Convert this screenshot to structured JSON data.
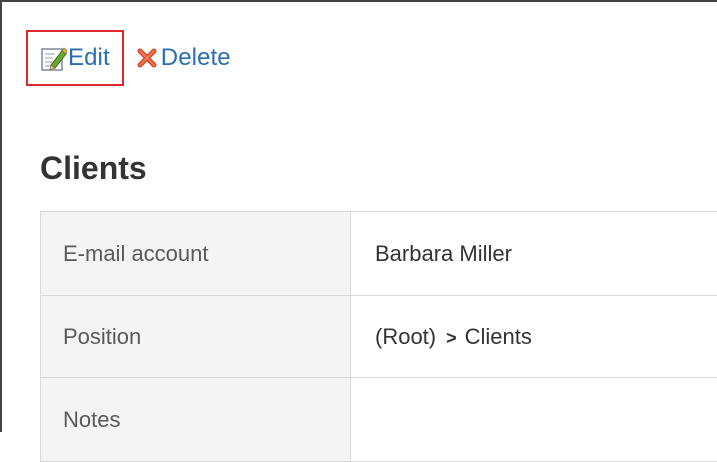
{
  "toolbar": {
    "edit_label": "Edit",
    "delete_label": "Delete",
    "highlight_color": "#e0272d",
    "link_color": "#2a6eb2"
  },
  "page": {
    "title": "Clients"
  },
  "details": {
    "rows": [
      {
        "label": "E-mail account",
        "value": "Barbara Miller"
      },
      {
        "label": "Position",
        "path_root": "(Root)",
        "path_separator": ">",
        "path_leaf": "Clients"
      },
      {
        "label": "Notes",
        "value": ""
      }
    ]
  },
  "icons": {
    "edit": "pencil-edit-icon",
    "delete": "red-x-delete-icon"
  }
}
